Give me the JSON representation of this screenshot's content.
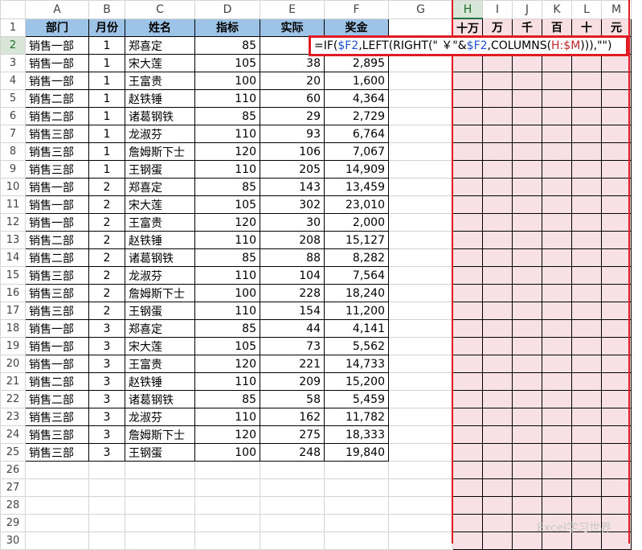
{
  "columns": [
    "A",
    "B",
    "C",
    "D",
    "E",
    "F",
    "G",
    "H",
    "I",
    "J",
    "K",
    "L",
    "M"
  ],
  "header": [
    "部门",
    "月份",
    "姓名",
    "指标",
    "实际",
    "奖金"
  ],
  "digit_headers": [
    "十万",
    "万",
    "千",
    "百",
    "十",
    "元"
  ],
  "rows": [
    [
      "销售一部",
      "1",
      "郑喜定",
      "85",
      "",
      ""
    ],
    [
      "销售一部",
      "1",
      "宋大莲",
      "105",
      "38",
      "2,895"
    ],
    [
      "销售一部",
      "1",
      "王富贵",
      "100",
      "20",
      "1,600"
    ],
    [
      "销售二部",
      "1",
      "赵铁锤",
      "110",
      "60",
      "4,364"
    ],
    [
      "销售二部",
      "1",
      "诸葛钢铁",
      "85",
      "29",
      "2,729"
    ],
    [
      "销售三部",
      "1",
      "龙淑芬",
      "110",
      "93",
      "6,764"
    ],
    [
      "销售三部",
      "1",
      "詹姆斯下士",
      "120",
      "106",
      "7,067"
    ],
    [
      "销售三部",
      "1",
      "王钢蛋",
      "110",
      "205",
      "14,909"
    ],
    [
      "销售一部",
      "2",
      "郑喜定",
      "85",
      "143",
      "13,459"
    ],
    [
      "销售一部",
      "2",
      "宋大莲",
      "105",
      "302",
      "23,010"
    ],
    [
      "销售一部",
      "2",
      "王富贵",
      "120",
      "30",
      "2,000"
    ],
    [
      "销售二部",
      "2",
      "赵铁锤",
      "110",
      "208",
      "15,127"
    ],
    [
      "销售二部",
      "2",
      "诸葛钢铁",
      "85",
      "88",
      "8,282"
    ],
    [
      "销售三部",
      "2",
      "龙淑芬",
      "110",
      "104",
      "7,564"
    ],
    [
      "销售三部",
      "2",
      "詹姆斯下士",
      "100",
      "228",
      "18,240"
    ],
    [
      "销售三部",
      "2",
      "王钢蛋",
      "110",
      "154",
      "11,200"
    ],
    [
      "销售一部",
      "3",
      "郑喜定",
      "85",
      "44",
      "4,141"
    ],
    [
      "销售一部",
      "3",
      "宋大莲",
      "105",
      "73",
      "5,562"
    ],
    [
      "销售一部",
      "3",
      "王富贵",
      "120",
      "221",
      "14,733"
    ],
    [
      "销售二部",
      "3",
      "赵铁锤",
      "110",
      "209",
      "15,200"
    ],
    [
      "销售二部",
      "3",
      "诸葛钢铁",
      "85",
      "58",
      "5,459"
    ],
    [
      "销售三部",
      "3",
      "龙淑芬",
      "110",
      "162",
      "11,782"
    ],
    [
      "销售三部",
      "3",
      "詹姆斯下士",
      "120",
      "275",
      "18,333"
    ],
    [
      "销售三部",
      "3",
      "王钢蛋",
      "100",
      "248",
      "19,840"
    ]
  ],
  "empty_row_numbers": [
    "26",
    "27",
    "28",
    "29",
    "30"
  ],
  "formula_parts": [
    {
      "t": "=IF(",
      "c": ""
    },
    {
      "t": "$F2",
      "c": "blue"
    },
    {
      "t": ",LEFT(RIGHT(\" ￥\"&",
      "c": ""
    },
    {
      "t": "$F2",
      "c": "blue"
    },
    {
      "t": ",COLUMNS(",
      "c": ""
    },
    {
      "t": "H:$M",
      "c": "red"
    },
    {
      "t": "))),\"\")",
      "c": ""
    }
  ],
  "watermark": "Excel学习世界",
  "colors": {
    "header_blue": "#9dc3e6",
    "pink_fill": "#f8e1e4",
    "highlight_red": "#e01b24"
  }
}
